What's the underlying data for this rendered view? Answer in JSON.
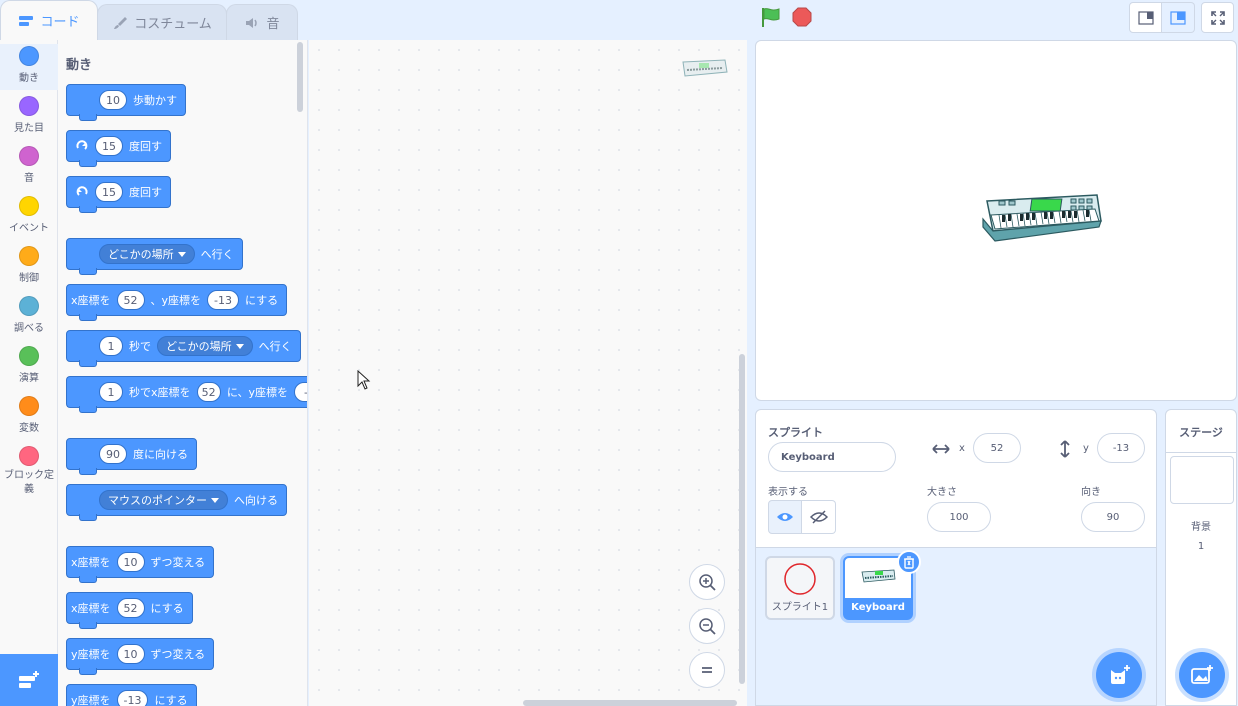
{
  "tabs": [
    {
      "label": "コード",
      "icon": "code-icon"
    },
    {
      "label": "コスチューム",
      "icon": "brush-icon"
    },
    {
      "label": "音",
      "icon": "speaker-icon"
    }
  ],
  "categories": [
    {
      "label": "動き",
      "color": "#4c97ff"
    },
    {
      "label": "見た目",
      "color": "#9966ff"
    },
    {
      "label": "音",
      "color": "#cf63cf"
    },
    {
      "label": "イベント",
      "color": "#ffd500"
    },
    {
      "label": "制御",
      "color": "#ffab19"
    },
    {
      "label": "調べる",
      "color": "#5cb1d6"
    },
    {
      "label": "演算",
      "color": "#59c059"
    },
    {
      "label": "変数",
      "color": "#ff8c1a"
    },
    {
      "label": "ブロック定義",
      "color": "#ff6680"
    }
  ],
  "palette": {
    "title": "動き",
    "blocks": {
      "move": {
        "value": "10",
        "text": "歩動かす"
      },
      "turn_right": {
        "value": "15",
        "text": "度回す"
      },
      "turn_left": {
        "value": "15",
        "text": "度回す"
      },
      "goto": {
        "menu": "どこかの場所",
        "text": "へ行く"
      },
      "gotoxy": {
        "t1": "x座標を",
        "x": "52",
        "t2": "、y座標を",
        "y": "-13",
        "t3": "にする"
      },
      "glide": {
        "value": "1",
        "t1": "秒で",
        "menu": "どこかの場所",
        "t2": "へ行く"
      },
      "glidexy": {
        "value": "1",
        "t1": "秒でx座標を",
        "x": "52",
        "t2": "に、y座標を",
        "y": "-"
      },
      "point": {
        "value": "90",
        "text": "度に向ける"
      },
      "pointto": {
        "menu": "マウスのポインター",
        "text": "へ向ける"
      },
      "changex": {
        "t1": "x座標を",
        "value": "10",
        "t2": "ずつ変える"
      },
      "setx": {
        "t1": "x座標を",
        "value": "52",
        "t2": "にする"
      },
      "changey": {
        "t1": "y座標を",
        "value": "10",
        "t2": "ずつ変える"
      },
      "sety": {
        "t1": "y座標を",
        "value": "-13",
        "t2": "にする"
      }
    }
  },
  "sprite_info": {
    "sprite_label": "スプライト",
    "sprite_name": "Keyboard",
    "x_label": "x",
    "x_value": "52",
    "y_label": "y",
    "y_value": "-13",
    "show_label": "表示する",
    "size_label": "大きさ",
    "size_value": "100",
    "direction_label": "向き",
    "direction_value": "90"
  },
  "sprites": [
    {
      "name": "スプライト1",
      "selected": false
    },
    {
      "name": "Keyboard",
      "selected": true
    }
  ],
  "stage_panel": {
    "title": "ステージ",
    "backdrops_label": "背景",
    "backdrops_count": "1"
  }
}
